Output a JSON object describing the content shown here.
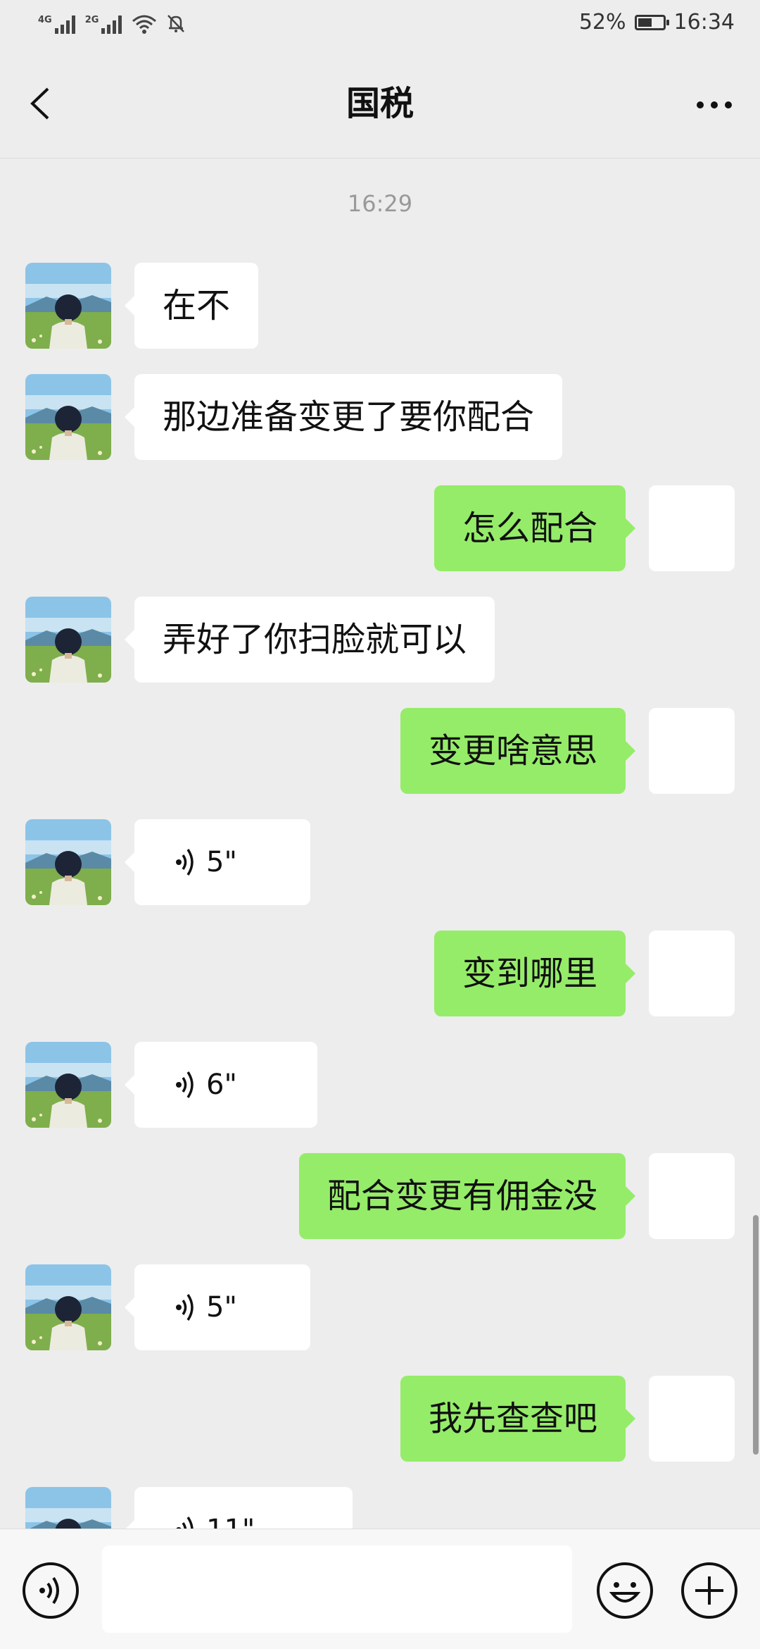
{
  "status_bar": {
    "net1": "4G",
    "net2": "2G",
    "battery_percent_text": "52%",
    "battery_level": 0.52,
    "time": "16:34",
    "icons": [
      "signal-icon",
      "signal-icon",
      "wifi-icon",
      "mute-bell-icon",
      "battery-icon"
    ]
  },
  "header": {
    "title": "国税",
    "back_icon": "chevron-left-icon",
    "more_icon": "more-dots-icon"
  },
  "chat": {
    "timestamp": "16:29",
    "messages": [
      {
        "side": "left",
        "type": "text",
        "text": "在不"
      },
      {
        "side": "left",
        "type": "text",
        "text": "那边准备变更了要你配合"
      },
      {
        "side": "right",
        "type": "text",
        "text": "怎么配合"
      },
      {
        "side": "left",
        "type": "text",
        "text": "弄好了你扫脸就可以"
      },
      {
        "side": "right",
        "type": "text",
        "text": "变更啥意思"
      },
      {
        "side": "left",
        "type": "voice",
        "duration": "5\""
      },
      {
        "side": "right",
        "type": "text",
        "text": "变到哪里"
      },
      {
        "side": "left",
        "type": "voice",
        "duration": "6\""
      },
      {
        "side": "right",
        "type": "text",
        "text": "配合变更有佣金没"
      },
      {
        "side": "left",
        "type": "voice",
        "duration": "5\""
      },
      {
        "side": "right",
        "type": "text",
        "text": "我先查查吧"
      },
      {
        "side": "left",
        "type": "voice",
        "duration": "11\""
      }
    ]
  },
  "input_bar": {
    "voice_icon": "voice-input-icon",
    "text_value": "",
    "emoji_icon": "emoji-icon",
    "plus_icon": "plus-icon"
  },
  "colors": {
    "background": "#ededed",
    "incoming_bubble": "#ffffff",
    "outgoing_bubble": "#95ec69"
  }
}
